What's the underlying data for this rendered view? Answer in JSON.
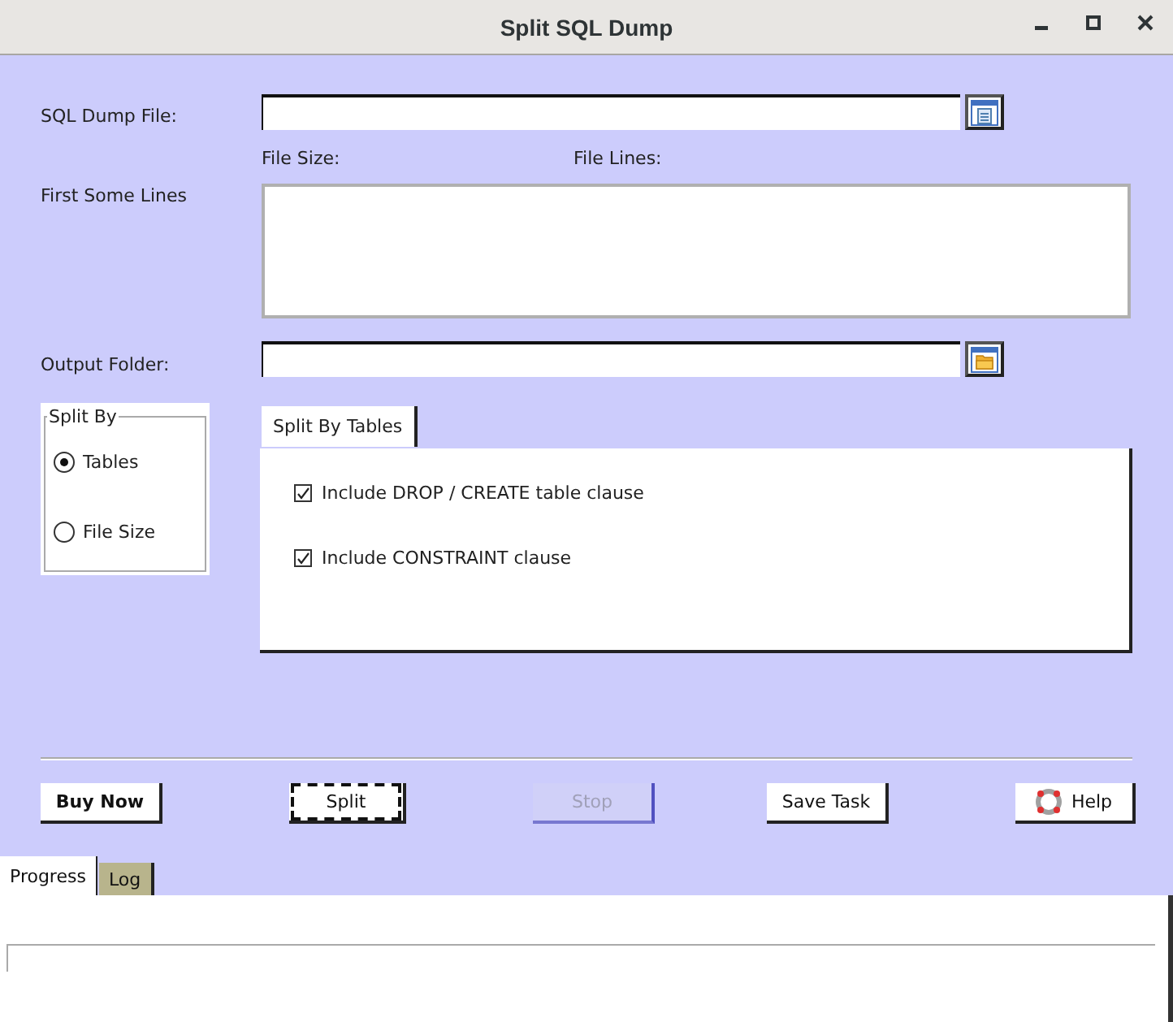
{
  "window": {
    "title": "Split SQL Dump"
  },
  "sql_dump_file": {
    "label": "SQL Dump File:"
  },
  "file_info": [
    {
      "label": "File Size:"
    },
    {
      "label": "File Lines:"
    }
  ],
  "first_lines": {
    "label": "First Some Lines"
  },
  "output_folder": {
    "label": "Output Folder:"
  },
  "split_by": {
    "title": "Split By",
    "options": [
      {
        "label": "Tables",
        "selected": true
      },
      {
        "label": "File Size",
        "selected": false
      }
    ]
  },
  "option_tabs": [
    {
      "label": "Split By Tables",
      "selected": true
    }
  ],
  "checkboxes": [
    {
      "label": "Include DROP / CREATE table clause",
      "checked": true
    },
    {
      "label": "Include CONSTRAINT clause",
      "checked": true
    }
  ],
  "buttons": [
    {
      "label": "Buy Now",
      "kind": "bold",
      "disabled": false
    },
    {
      "label": "Split",
      "kind": "focused",
      "disabled": false
    },
    {
      "label": "Stop",
      "kind": "plain",
      "disabled": true
    },
    {
      "label": "Save Task",
      "kind": "plain",
      "disabled": false
    },
    {
      "label": "Help",
      "kind": "help",
      "disabled": false
    }
  ],
  "bottom_tabs": [
    {
      "label": "Progress",
      "selected": true
    },
    {
      "label": "Log",
      "selected": false
    }
  ],
  "progress": {
    "level": 0
  }
}
